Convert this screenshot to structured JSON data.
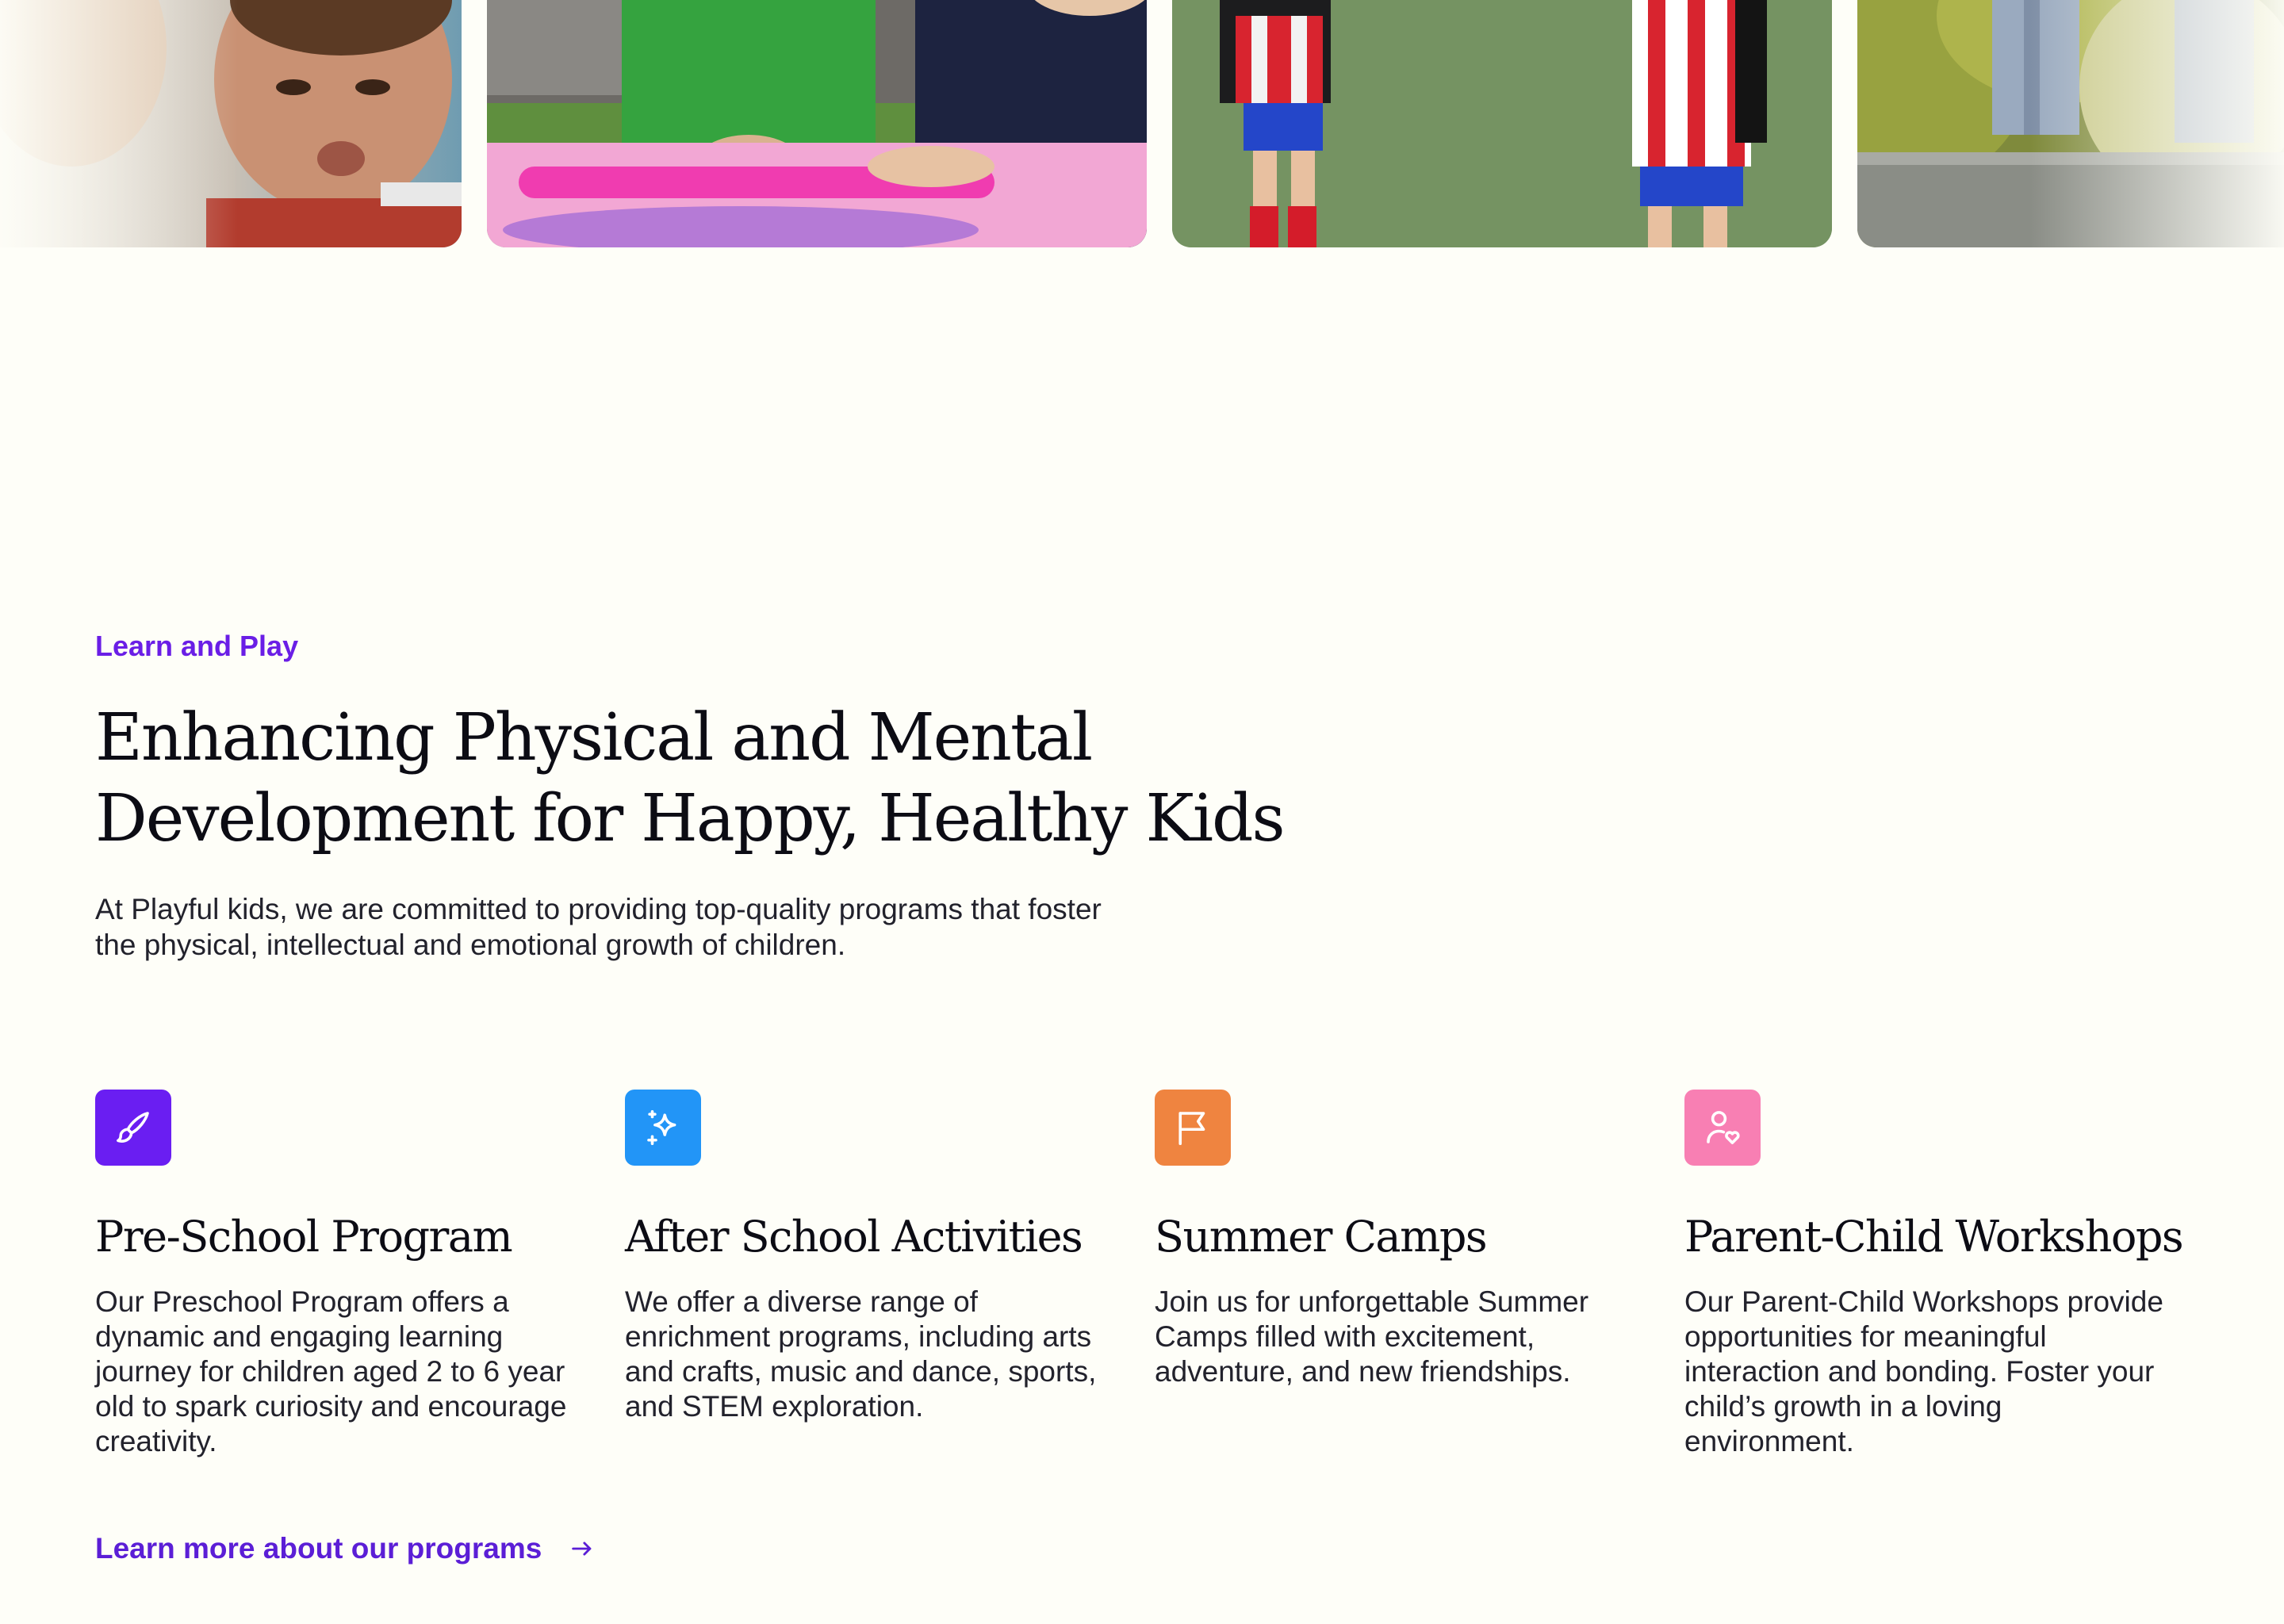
{
  "photos": [
    {
      "name": "photo-boy-making-face"
    },
    {
      "name": "photo-kids-at-paddling-pool"
    },
    {
      "name": "photo-kids-playing-soccer"
    },
    {
      "name": "photo-kids-on-wall"
    }
  ],
  "section": {
    "eyebrow": "Learn and Play",
    "heading_line_1": "Enhancing Physical and Mental",
    "heading_line_2": "Development for Happy, Healthy Kids",
    "intro": "At Playful kids, we are committed to providing top-quality programs that foster the physical, intellectual and emotional growth of children."
  },
  "programs": [
    {
      "title": "Pre-School Program",
      "description": "Our Preschool Program offers a dynamic and engaging learning journey for children aged 2 to 6 year old to spark curiosity and encourage creativity.",
      "icon": "paintbrush-icon",
      "color": "#6a1ef2"
    },
    {
      "title": "After School Activities",
      "description": "We offer a diverse range of enrichment programs, including arts and crafts, music and dance, sports, and STEM exploration.",
      "icon": "sparkles-icon",
      "color": "#2295f7"
    },
    {
      "title": "Summer Camps",
      "description": "Join us for unforgettable Summer Camps filled with excitement, adventure, and new friendships.",
      "icon": "flag-icon",
      "color": "#ef8440"
    },
    {
      "title": "Parent-Child Workshops",
      "description": "Our Parent-Child Workshops provide opportunities for meaningful interaction and bonding. Foster your child’s growth in a loving environment.",
      "icon": "user-heart-icon",
      "color": "#f87fb3"
    }
  ],
  "cta": {
    "label": "Learn more about our programs",
    "icon": "arrow-right-icon"
  },
  "colors": {
    "background": "#fefef8",
    "accent": "#6a1ee6",
    "heading": "#0c0c14"
  }
}
